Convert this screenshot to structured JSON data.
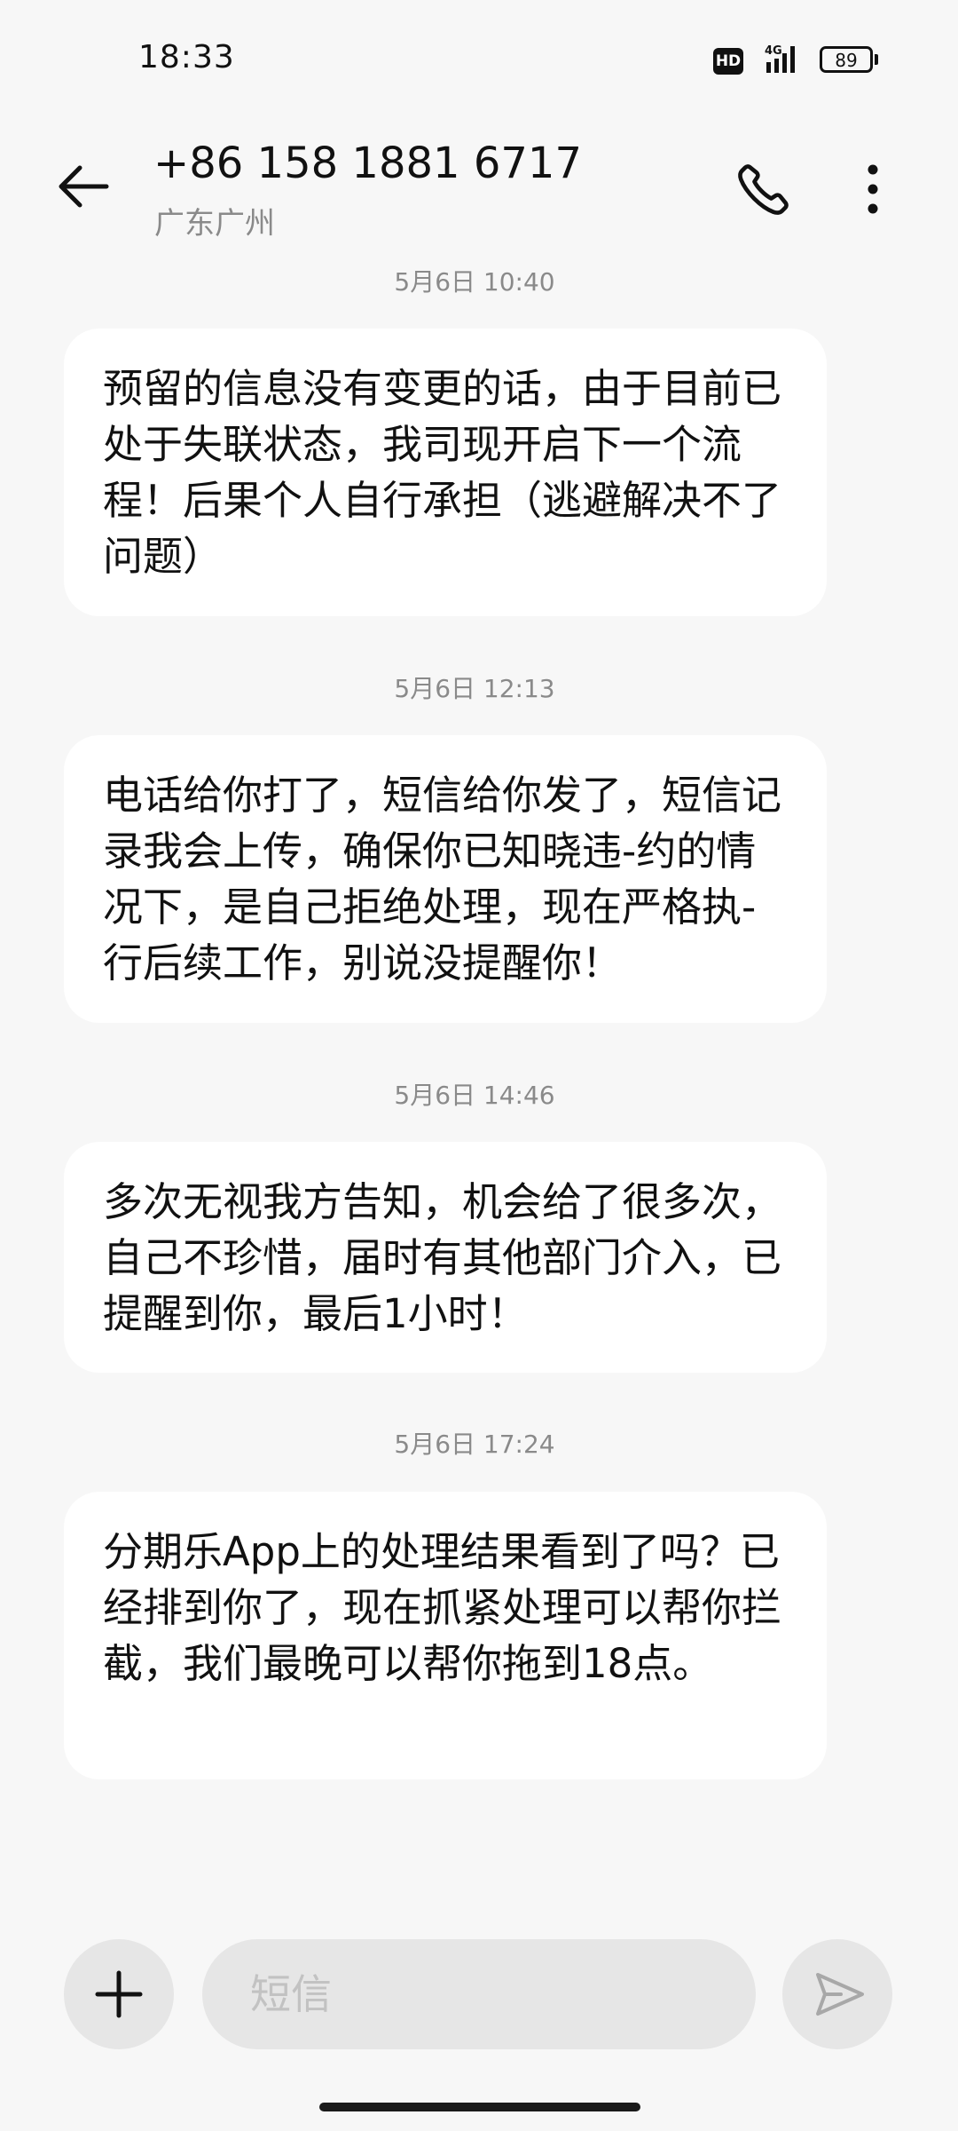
{
  "status_bar": {
    "time": "18:33",
    "hd_label": "HD",
    "network_label": "4G",
    "battery_level": "89"
  },
  "header": {
    "contact_number": "+86 158 1881 6717",
    "contact_location": "广东广州",
    "back_icon": "arrow-left-icon",
    "call_icon": "phone-icon",
    "more_icon": "more-vertical-icon"
  },
  "messages": [
    {
      "timestamp": "5月6日 10:40",
      "text": "预留的信息没有变更的话，由于目前已处于失联状态，我司现开启下一个流程！后果个人自行承担（逃避解决不了问题）"
    },
    {
      "timestamp": "5月6日 12:13",
      "text": "电话给你打了，短信给你发了，短信记录我会上传，确保你已知晓违-约的情况下，是自己拒绝处理，现在严格执-行后续工作，别说没提醒你！"
    },
    {
      "timestamp": "5月6日 14:46",
      "text": "多次无视我方告知，机会给了很多次，自己不珍惜，届时有其他部门介入，已提醒到你，最后1小时！"
    },
    {
      "timestamp": "5月6日 17:24",
      "text": "分期乐App上的处理结果看到了吗？已经排到你了，现在抓紧处理可以帮你拦截，我们最晚可以帮你拖到18点。"
    }
  ],
  "composer": {
    "placeholder": "短信",
    "add_icon": "plus-icon",
    "send_icon": "send-icon"
  }
}
